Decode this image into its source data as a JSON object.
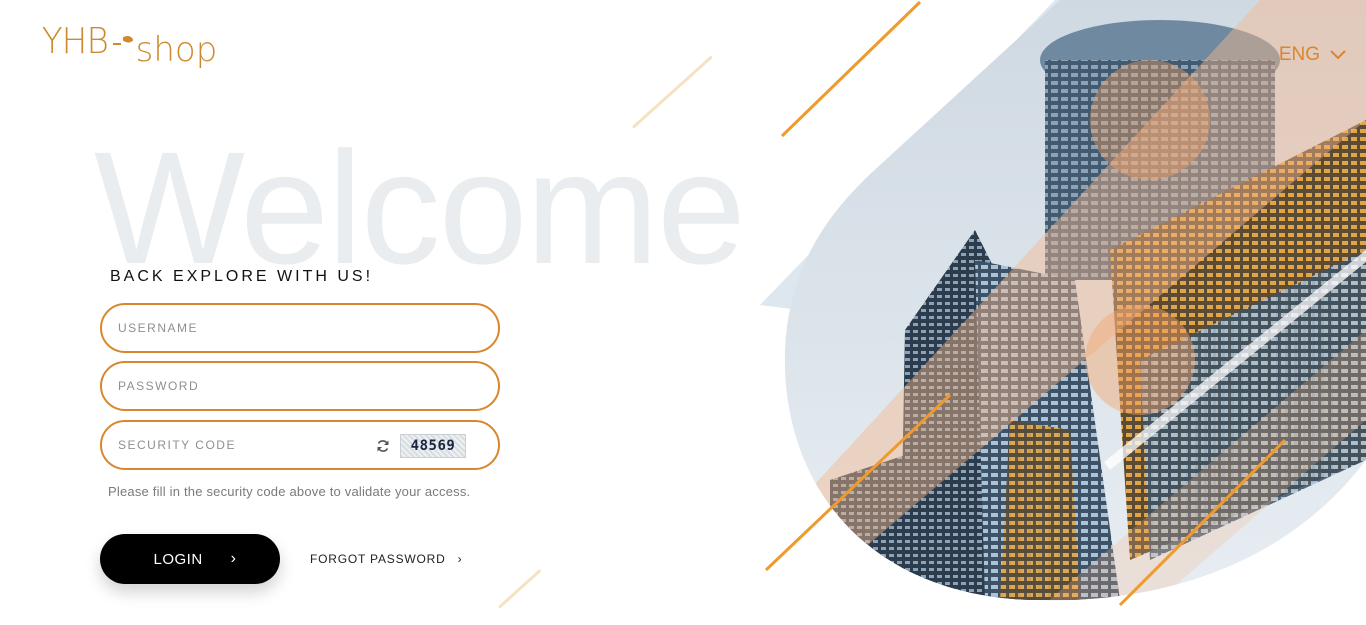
{
  "header": {
    "logo_brand": "YHB",
    "logo_shop": "shop",
    "language": "ENG"
  },
  "hero": {
    "watermark": "Welcome",
    "tagline": "BACK EXPLORE WITH US!"
  },
  "form": {
    "username_placeholder": "USERNAME",
    "password_placeholder": "PASSWORD",
    "security_placeholder": "SECURITY CODE",
    "captcha_text": "48569",
    "hint": "Please fill in the security code above to validate your access.",
    "login_label": "LOGIN",
    "login_chevron": "›",
    "forgot_label": "FORGOT PASSWORD",
    "forgot_chevron": "›"
  },
  "colors": {
    "accent": "#d9862e",
    "button": "#000000",
    "watermark": "#e9edef"
  },
  "icons": [
    "chevron-down-icon",
    "refresh-icon",
    "chevron-right-icon"
  ]
}
